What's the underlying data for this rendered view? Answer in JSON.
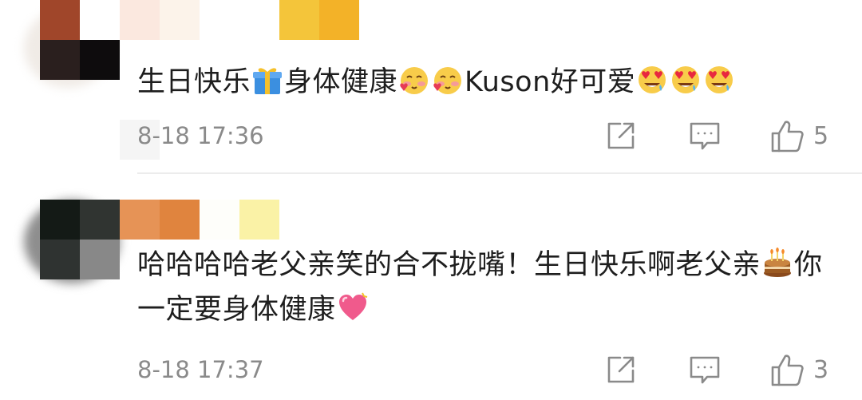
{
  "comments": [
    {
      "segments": [
        {
          "type": "text",
          "value": "生日快乐"
        },
        {
          "type": "emoji",
          "icon": "gift-emoji"
        },
        {
          "type": "text",
          "value": "身体健康"
        },
        {
          "type": "emoji",
          "icon": "blush-kiss-emoji"
        },
        {
          "type": "emoji",
          "icon": "blush-kiss-emoji"
        },
        {
          "type": "text",
          "value": "Kuson好可爱"
        },
        {
          "type": "emoji",
          "icon": "heart-eyes-emoji"
        },
        {
          "type": "emoji",
          "icon": "heart-eyes-emoji"
        },
        {
          "type": "emoji",
          "icon": "heart-eyes-emoji"
        }
      ],
      "time": "8-18 17:36",
      "likes": "5"
    },
    {
      "segments": [
        {
          "type": "text",
          "value": "哈哈哈哈老父亲笑的合不拢嘴！生日快乐啊老父亲"
        },
        {
          "type": "emoji",
          "icon": "birthday-cake-emoji"
        },
        {
          "type": "text",
          "value": "你一定要身体健康"
        },
        {
          "type": "emoji",
          "icon": "growing-heart-emoji"
        }
      ],
      "time": "8-18 17:37",
      "likes": "3"
    }
  ],
  "icons": {
    "share": "share-icon",
    "comment": "comment-icon",
    "like": "thumbs-up-icon"
  },
  "colors": {
    "text": "#1e1e1e",
    "meta": "#8a8a8a",
    "divider": "#ececec"
  }
}
